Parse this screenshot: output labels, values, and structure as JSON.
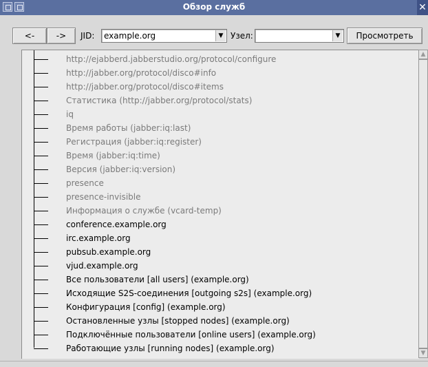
{
  "window": {
    "title": "Обзор служб",
    "close_glyph": "✕"
  },
  "toolbar": {
    "back_label": "<-",
    "forward_label": "->",
    "jid_label": "JID:",
    "jid_value": "example.org",
    "node_label": "Узел:",
    "node_value": "",
    "view_label": "Просмотреть"
  },
  "tree": {
    "items": [
      {
        "label": "http://ejabberd.jabberstudio.org/protocol/configure",
        "style": "muted"
      },
      {
        "label": "http://jabber.org/protocol/disco#info",
        "style": "muted"
      },
      {
        "label": "http://jabber.org/protocol/disco#items",
        "style": "muted"
      },
      {
        "label": "Статистика (http://jabber.org/protocol/stats)",
        "style": "muted"
      },
      {
        "label": "iq",
        "style": "muted"
      },
      {
        "label": "Время работы (jabber:iq:last)",
        "style": "muted"
      },
      {
        "label": "Регистрация (jabber:iq:register)",
        "style": "muted"
      },
      {
        "label": "Время (jabber:iq:time)",
        "style": "muted"
      },
      {
        "label": "Версия (jabber:iq:version)",
        "style": "muted"
      },
      {
        "label": "presence",
        "style": "muted"
      },
      {
        "label": "presence-invisible",
        "style": "muted"
      },
      {
        "label": "Информация о службе (vcard-temp)",
        "style": "muted"
      },
      {
        "label": "conference.example.org",
        "style": "dark"
      },
      {
        "label": "irc.example.org",
        "style": "dark"
      },
      {
        "label": "pubsub.example.org",
        "style": "dark"
      },
      {
        "label": "vjud.example.org",
        "style": "dark"
      },
      {
        "label": "Все пользователи [all users] (example.org)",
        "style": "dark"
      },
      {
        "label": "Исходящие S2S-соединения [outgoing s2s] (example.org)",
        "style": "dark"
      },
      {
        "label": "Конфигурация [config] (example.org)",
        "style": "dark"
      },
      {
        "label": "Остановленные узлы [stopped nodes] (example.org)",
        "style": "dark"
      },
      {
        "label": "Подключённые пользователи [online users] (example.org)",
        "style": "dark"
      },
      {
        "label": "Работающие узлы [running nodes] (example.org)",
        "style": "dark"
      }
    ]
  },
  "colors": {
    "titlebar": "#5a6fa0",
    "muted_text": "#7a7a7a"
  }
}
